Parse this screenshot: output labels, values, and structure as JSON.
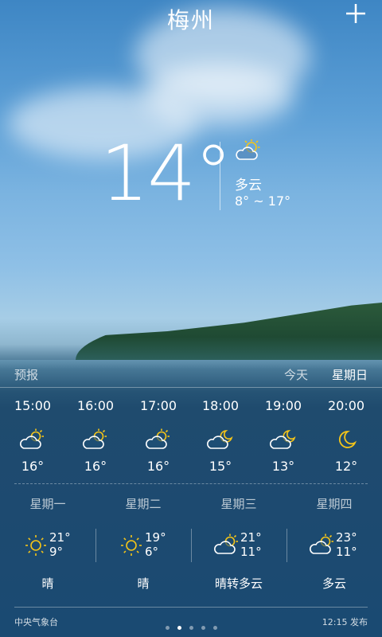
{
  "header": {
    "city": "梅州",
    "add_label": "+"
  },
  "current": {
    "temperature": "14°",
    "condition": "多云",
    "range": "8° ~ 17°",
    "icon": "partly-cloudy-day-icon"
  },
  "forecast_header": {
    "label": "预报",
    "today": "今天",
    "selected_day": "星期日"
  },
  "hourly": [
    {
      "time": "15:00",
      "icon": "partly-cloudy-day-icon",
      "temp": "16°"
    },
    {
      "time": "16:00",
      "icon": "partly-cloudy-day-icon",
      "temp": "16°"
    },
    {
      "time": "17:00",
      "icon": "partly-cloudy-day-icon",
      "temp": "16°"
    },
    {
      "time": "18:00",
      "icon": "partly-cloudy-night-icon",
      "temp": "15°"
    },
    {
      "time": "19:00",
      "icon": "partly-cloudy-night-icon",
      "temp": "13°"
    },
    {
      "time": "20:00",
      "icon": "moon-icon",
      "temp": "12°"
    }
  ],
  "daily": [
    {
      "day": "星期一",
      "icon": "sun-icon",
      "high": "21°",
      "low": "9°",
      "condition": "晴"
    },
    {
      "day": "星期二",
      "icon": "sun-icon",
      "high": "19°",
      "low": "6°",
      "condition": "晴"
    },
    {
      "day": "星期三",
      "icon": "partly-cloudy-day-icon",
      "high": "21°",
      "low": "11°",
      "condition": "晴转多云"
    },
    {
      "day": "星期四",
      "icon": "partly-cloudy-day-icon",
      "high": "23°",
      "low": "11°",
      "condition": "多云"
    }
  ],
  "footer": {
    "source": "中央气象台",
    "published": "12:15 发布",
    "page_count": 5,
    "active_page": 1
  },
  "colors": {
    "sun": "#f5c518",
    "text": "#ffffff"
  }
}
